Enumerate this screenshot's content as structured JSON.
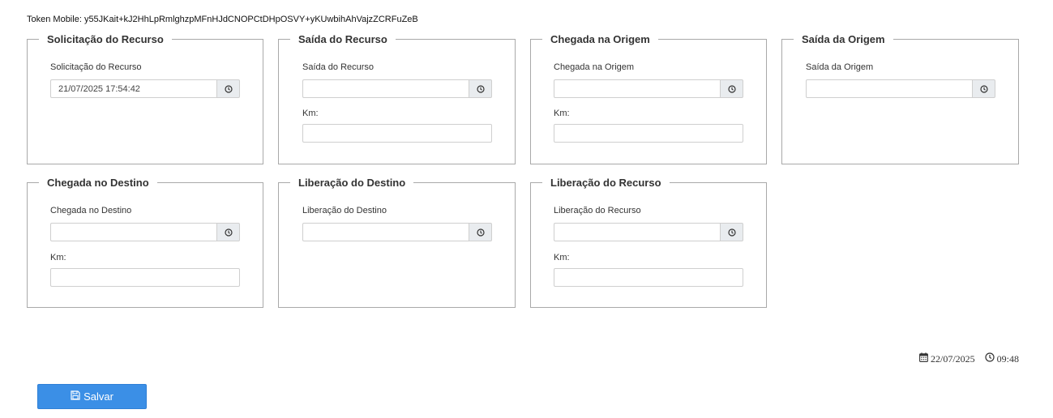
{
  "token": {
    "label": "Token Mobile:",
    "value": "y55JKait+kJ2HhLpRmlghzpMFnHJdCNOPCtDHpOSVY+yKUwbihAhVajzZCRFuZeB"
  },
  "panels": [
    {
      "title": "Solicitação do Recurso",
      "field_label": "Solicitação do Recurso",
      "value": "21/07/2025 17:54:42"
    },
    {
      "title": "Saída do Recurso",
      "field_label": "Saída do Recurso",
      "value": "",
      "km_label": "Km:"
    },
    {
      "title": "Chegada na Origem",
      "field_label": "Chegada na Origem",
      "value": "",
      "km_label": "Km:"
    },
    {
      "title": "Saída da Origem",
      "field_label": "Saída da Origem",
      "value": ""
    },
    {
      "title": "Chegada no Destino",
      "field_label": "Chegada no Destino",
      "value": "",
      "km_label": "Km:"
    },
    {
      "title": "Liberação do Destino",
      "field_label": "Liberação do Destino",
      "value": ""
    },
    {
      "title": "Liberação do Recurso",
      "field_label": "Liberação do Recurso",
      "value": "",
      "km_label": "Km:"
    }
  ],
  "footer": {
    "date": "22/07/2025",
    "time": "09:48"
  },
  "save_button": {
    "label": "Salvar",
    "color": "#3b8fe6"
  },
  "icons": {
    "clock": "clock-icon",
    "calendar": "calendar-icon",
    "save": "floppy-disk-icon"
  }
}
